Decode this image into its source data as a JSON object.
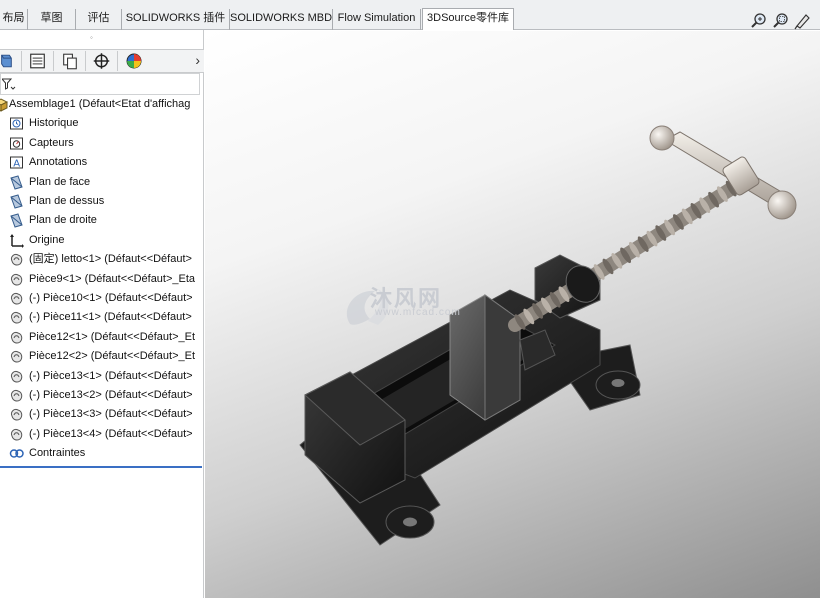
{
  "tabs": [
    {
      "label": "布局",
      "active": false
    },
    {
      "label": "草图",
      "active": false
    },
    {
      "label": "评估",
      "active": false
    },
    {
      "label": "SOLIDWORKS 插件",
      "active": false
    },
    {
      "label": "SOLIDWORKS MBD",
      "active": false
    },
    {
      "label": "Flow Simulation",
      "active": false
    },
    {
      "label": "3DSource零件库",
      "active": true
    }
  ],
  "view_tools": [
    "zoom-to-fit-icon",
    "zoom-to-area-icon",
    "previous-view-icon"
  ],
  "feature_manager": {
    "tabs": [
      "feature-tree-icon",
      "property-manager-icon",
      "configuration-manager-icon",
      "dimxpert-icon",
      "display-manager-icon"
    ],
    "more": "›",
    "filter_icon": "filter-icon"
  },
  "tree": [
    {
      "label": "Assemblage1  (Défaut<Etat d'affichag",
      "icon": "assembly-icon"
    },
    {
      "label": "Historique",
      "icon": "history-icon"
    },
    {
      "label": "Capteurs",
      "icon": "sensors-icon"
    },
    {
      "label": "Annotations",
      "icon": "annotations-icon"
    },
    {
      "label": "Plan de face",
      "icon": "plane-icon"
    },
    {
      "label": "Plan de dessus",
      "icon": "plane-icon"
    },
    {
      "label": "Plan de droite",
      "icon": "plane-icon"
    },
    {
      "label": "Origine",
      "icon": "origin-icon"
    },
    {
      "label": "(固定) letto<1> (Défaut<<Défaut>",
      "icon": "part-icon"
    },
    {
      "label": "Pièce9<1> (Défaut<<Défaut>_Eta",
      "icon": "part-icon"
    },
    {
      "label": "(-) Pièce10<1> (Défaut<<Défaut>",
      "icon": "part-icon"
    },
    {
      "label": "(-) Pièce11<1> (Défaut<<Défaut>",
      "icon": "part-icon"
    },
    {
      "label": "Pièce12<1> (Défaut<<Défaut>_Et",
      "icon": "part-icon"
    },
    {
      "label": "Pièce12<2> (Défaut<<Défaut>_Et",
      "icon": "part-icon"
    },
    {
      "label": "(-) Pièce13<1> (Défaut<<Défaut>",
      "icon": "part-icon"
    },
    {
      "label": "(-) Pièce13<2> (Défaut<<Défaut>",
      "icon": "part-icon"
    },
    {
      "label": "(-) Pièce13<3> (Défaut<<Défaut>",
      "icon": "part-icon"
    },
    {
      "label": "(-) Pièce13<4> (Défaut<<Défaut>",
      "icon": "part-icon"
    },
    {
      "label": "Contraintes",
      "icon": "mates-icon"
    }
  ],
  "watermark": {
    "text": "沐风网",
    "url": "www.mfcad.com"
  },
  "colors": {
    "accent": "#3a6fc4",
    "model": "#1c1c1c",
    "handle": "#e3ddd6"
  }
}
